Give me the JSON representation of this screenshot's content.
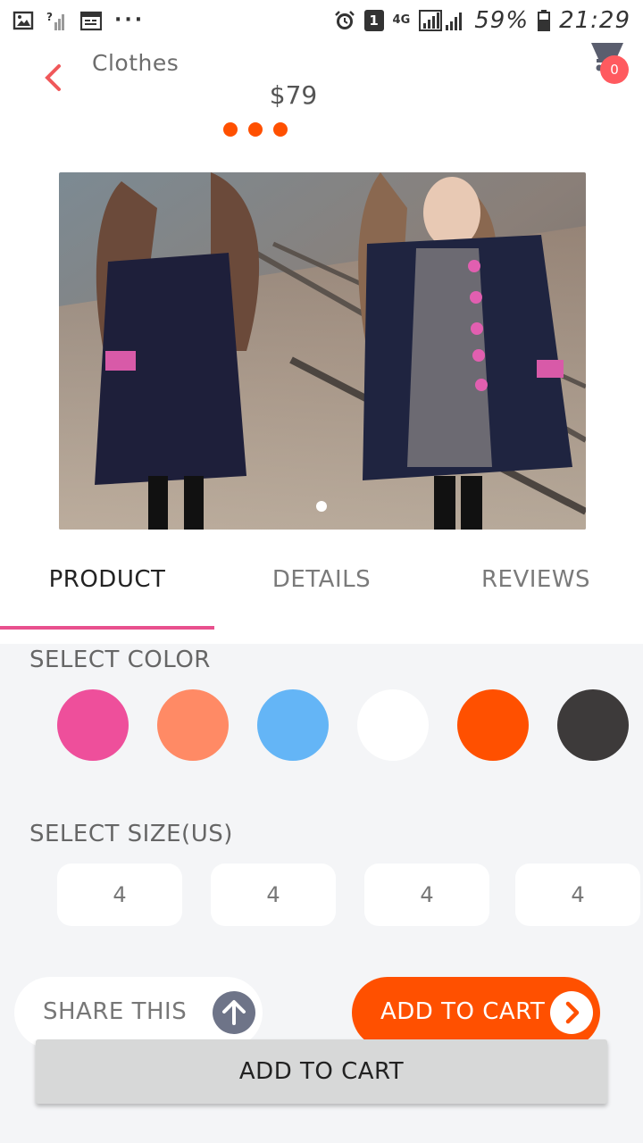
{
  "status_bar": {
    "network": "4G",
    "sim": "1",
    "battery": "59%",
    "time": "21:29",
    "icons": [
      "image-icon",
      "signal-unknown-icon",
      "calendar-icon",
      "more-dots-icon",
      "alarm-icon",
      "sim-icon",
      "network-4g-icon",
      "signal-icon",
      "battery-icon"
    ]
  },
  "header": {
    "title": "Clothes",
    "price": "$79",
    "cart_count": "0",
    "pager_dots": 3
  },
  "image_carousel": {
    "active_index": 0
  },
  "tabs": [
    {
      "label": "PRODUCT",
      "active": true
    },
    {
      "label": "DETAILS",
      "active": false
    },
    {
      "label": "REVIEWS",
      "active": false
    }
  ],
  "colors": {
    "label": "SELECT COLOR",
    "swatches": [
      "#ee4f9b",
      "#ff8a65",
      "#64b5f6",
      "#ffffff",
      "#ff5000",
      "#3d3a3a"
    ]
  },
  "sizes": {
    "label": "SELECT SIZE(US)",
    "options": [
      "4",
      "4",
      "4",
      "4"
    ]
  },
  "actions": {
    "share_label": "SHARE THIS",
    "add_to_cart_label": "ADD TO CART",
    "bottom_button_label": "ADD TO CART"
  },
  "theme": {
    "accent": "#ff5000",
    "tab_underline": "#e8508d",
    "back_arrow": "#f0585a",
    "badge": "#ff5a5f"
  }
}
